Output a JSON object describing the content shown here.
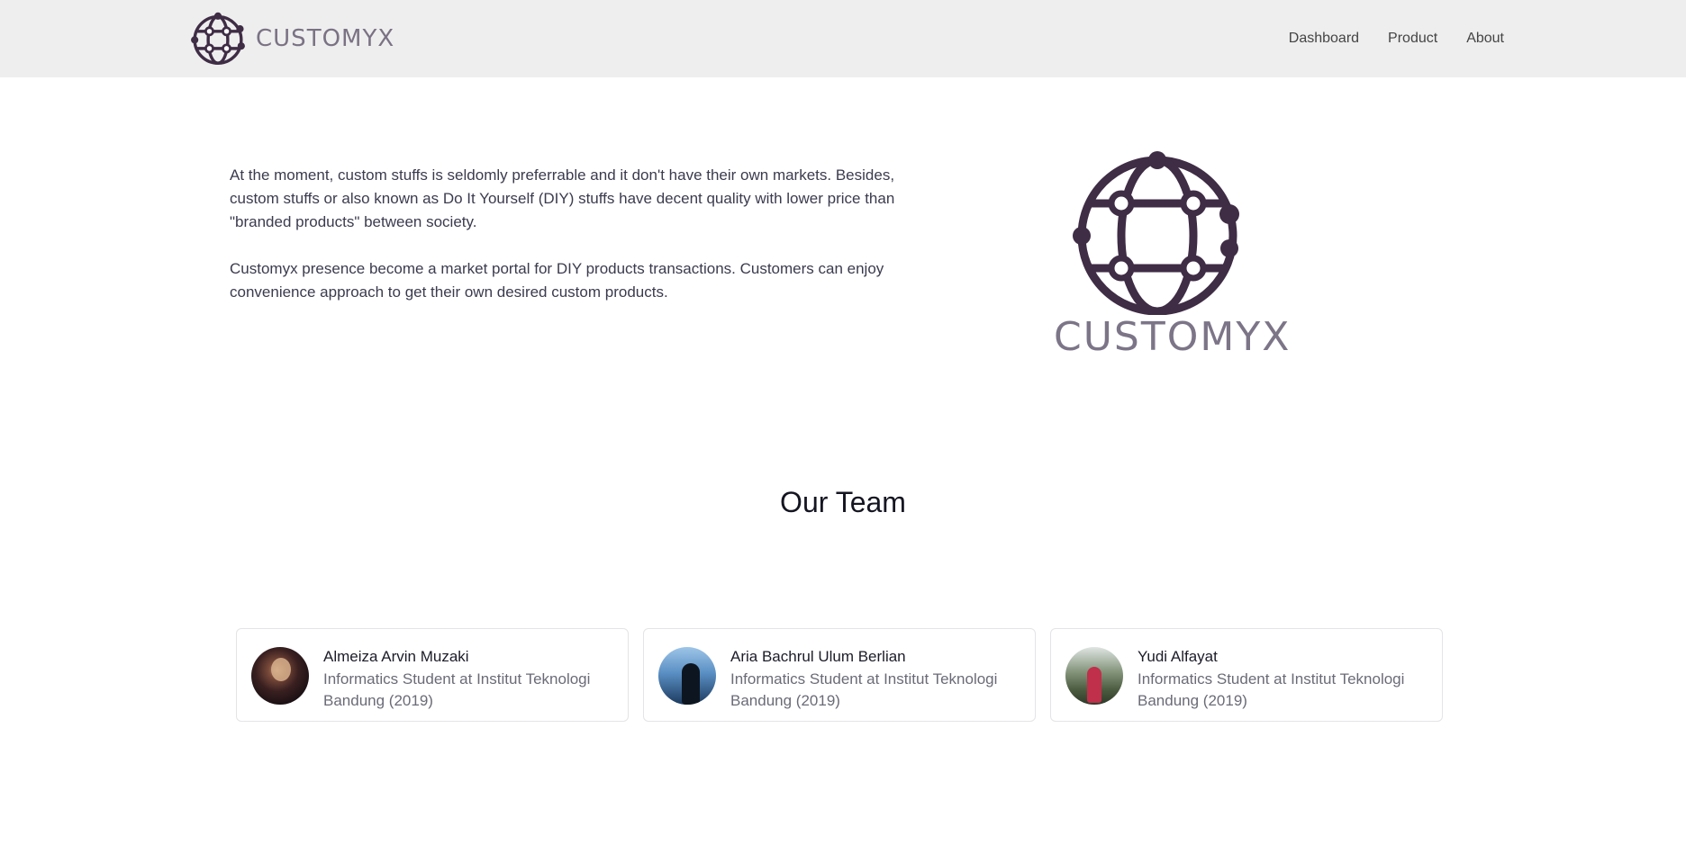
{
  "brand": {
    "name": "CUSTOMYX",
    "logo_icon": "globe-network-icon",
    "color": "#3f2c45"
  },
  "nav": {
    "links": [
      "Dashboard",
      "Product",
      "About"
    ]
  },
  "intro": {
    "paragraphs": [
      "At the moment, custom stuffs is seldomly preferrable and it don't have their own markets. Besides, custom stuffs or also known as Do It Yourself (DIY) stuffs have decent quality with lower price than \"branded products\" between society.",
      "Customyx presence become a market portal for DIY products transactions. Customers can enjoy convenience approach to get their own desired custom products."
    ]
  },
  "hero_logo": {
    "text": "CUSTOMYX"
  },
  "team": {
    "title": "Our Team",
    "members": [
      {
        "name": "Almeiza Arvin Muzaki",
        "role": "Informatics Student at Institut Teknologi Bandung (2019)"
      },
      {
        "name": "Aria Bachrul Ulum Berlian",
        "role": "Informatics Student at Institut Teknologi Bandung (2019)"
      },
      {
        "name": "Yudi Alfayat",
        "role": "Informatics Student at Institut Teknologi Bandung (2019)"
      }
    ]
  }
}
